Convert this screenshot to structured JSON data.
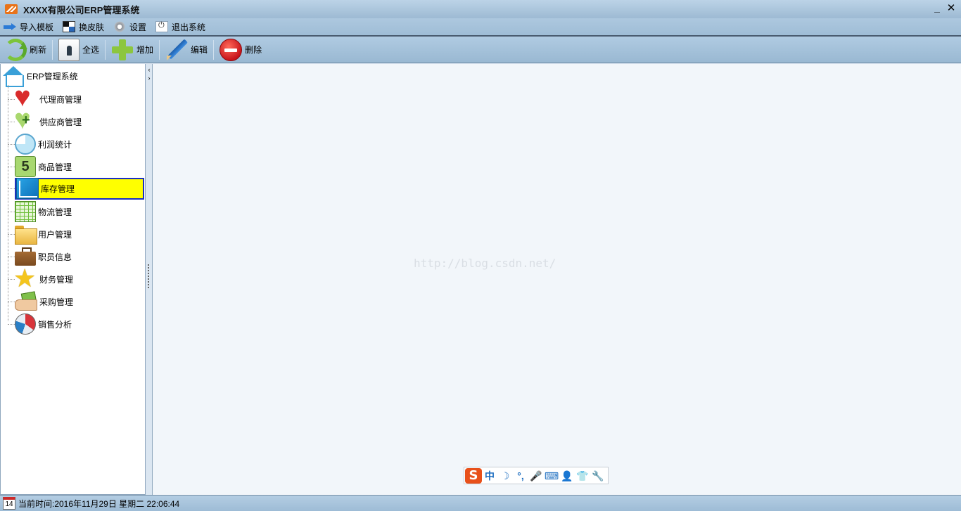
{
  "window": {
    "title": "XXXX有限公司ERP管理系统",
    "minimize_glyph": "_",
    "close_glyph": "✕"
  },
  "menu": [
    {
      "label": "导入模板",
      "icon": "import-arrow-icon"
    },
    {
      "label": "换皮肤",
      "icon": "skin-icon"
    },
    {
      "label": "设置",
      "icon": "gear-icon"
    },
    {
      "label": "退出系统",
      "icon": "power-icon"
    }
  ],
  "toolbar": [
    {
      "label": "刷新",
      "icon": "refresh-icon"
    },
    {
      "label": "全选",
      "icon": "select-all-icon"
    },
    {
      "label": "增加",
      "icon": "add-icon"
    },
    {
      "label": "编辑",
      "icon": "edit-pencil-icon"
    },
    {
      "label": "删除",
      "icon": "delete-icon"
    }
  ],
  "tree": {
    "root": {
      "label": "ERP管理系统",
      "icon": "home-icon"
    },
    "items": [
      {
        "label": "代理商管理",
        "icon": "heart-icon"
      },
      {
        "label": "供应商管理",
        "icon": "heart-plus-icon"
      },
      {
        "label": "利润统计",
        "icon": "pie-chart-icon"
      },
      {
        "label": "商品管理",
        "icon": "number-five-icon"
      },
      {
        "label": "库存管理",
        "icon": "stock-chart-icon",
        "selected": true
      },
      {
        "label": "物流管理",
        "icon": "spreadsheet-icon"
      },
      {
        "label": "用户管理",
        "icon": "folder-icon"
      },
      {
        "label": "职员信息",
        "icon": "briefcase-icon"
      },
      {
        "label": "财务管理",
        "icon": "star-icon"
      },
      {
        "label": "采购管理",
        "icon": "money-hand-icon"
      },
      {
        "label": "销售分析",
        "icon": "beach-ball-icon"
      }
    ],
    "selected_color": "#ffff00",
    "selected_border": "#1a2fbf"
  },
  "splitter": {
    "collapse_left": "‹",
    "expand_right": "›"
  },
  "content": {
    "watermark": "http://blog.csdn.net/"
  },
  "ime": {
    "logo": "S",
    "buttons": [
      "中",
      "☽",
      "°,",
      "🎤",
      "⌨",
      "👤",
      "👕",
      "🔧"
    ]
  },
  "status": {
    "calendar_day": "14",
    "text": "当前时间:2016年11月29日 星期二 22:06:44"
  }
}
